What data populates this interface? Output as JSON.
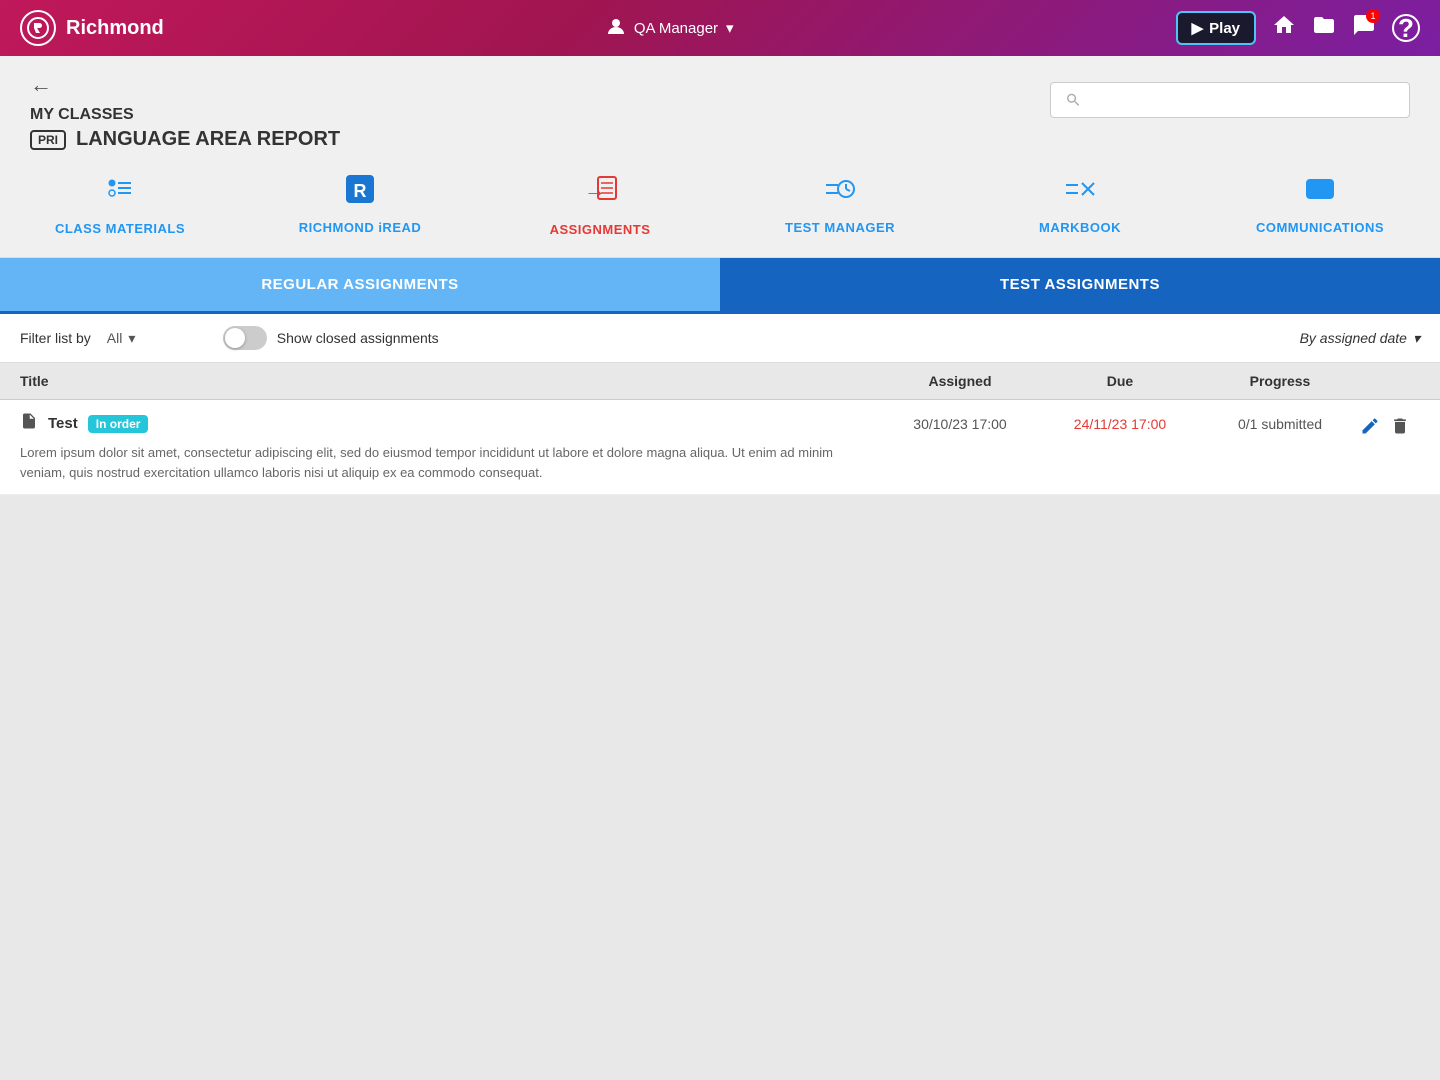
{
  "topnav": {
    "logo_text": "Richmond",
    "logo_icon": "R",
    "user_label": "QA Manager",
    "play_label": "Play",
    "notification_count": "1"
  },
  "header": {
    "back_label": "←",
    "breadcrumb": "MY CLASSES",
    "pri_badge": "PRI",
    "page_title": "LANGUAGE AREA REPORT",
    "search_placeholder": ""
  },
  "nav_items": [
    {
      "id": "class-materials",
      "icon": "≡○",
      "label": "CLASS MATERIALS",
      "color": "blue"
    },
    {
      "id": "richmond-iread",
      "icon": "R",
      "label": "RICHMOND iREAD",
      "color": "blue"
    },
    {
      "id": "assignments",
      "icon": "→≡",
      "label": "ASSIGNMENTS",
      "color": "red"
    },
    {
      "id": "test-manager",
      "icon": "≡⏱",
      "label": "TEST MANAGER",
      "color": "blue"
    },
    {
      "id": "markbook",
      "icon": "≡✗",
      "label": "MARKBOOK",
      "color": "blue"
    },
    {
      "id": "communications",
      "icon": "💬",
      "label": "COMMUNICATIONS",
      "color": "blue"
    }
  ],
  "tabs": [
    {
      "id": "regular",
      "label": "REGULAR ASSIGNMENTS",
      "active": true
    },
    {
      "id": "test",
      "label": "TEST ASSIGNMENTS",
      "active": false
    }
  ],
  "filter": {
    "filter_label": "Filter list by",
    "filter_value": "All",
    "show_closed_label": "Show closed assignments",
    "sort_label": "By assigned date"
  },
  "table": {
    "headers": [
      "Title",
      "Assigned",
      "Due",
      "Progress",
      ""
    ],
    "rows": [
      {
        "icon": "📋",
        "title": "Test",
        "status": "In order",
        "description": "Lorem ipsum dolor sit amet, consectetur adipiscing elit, sed do eiusmod tempor incididunt ut labore et dolore magna aliqua. Ut enim ad minim veniam, quis nostrud exercitation ullamco laboris nisi ut aliquip ex ea commodo consequat.",
        "assigned": "30/10/23 17:00",
        "due": "24/11/23 17:00",
        "progress": "0/1 submitted"
      }
    ]
  }
}
